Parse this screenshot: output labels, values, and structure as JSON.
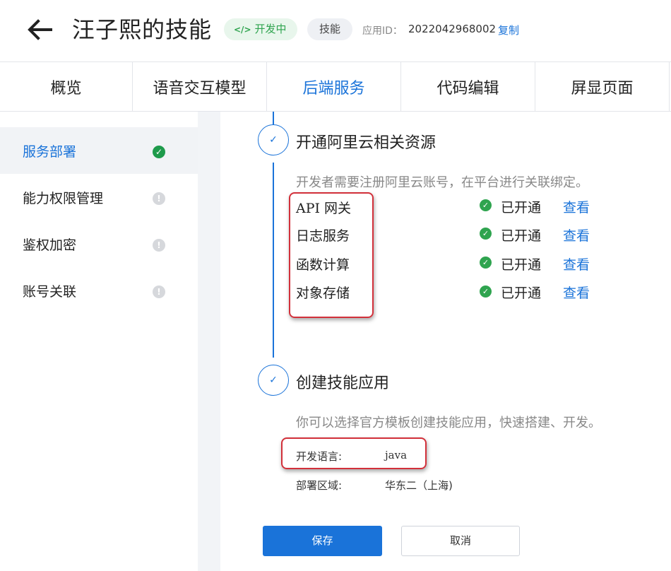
{
  "header": {
    "title": "汪子熙的技能",
    "status_code": "</>",
    "status": "开发中",
    "type": "技能",
    "app_id_label": "应用ID：",
    "app_id": "2022042968002",
    "copy_label": "复制"
  },
  "tabs": [
    {
      "label": "概览"
    },
    {
      "label": "语音交互模型"
    },
    {
      "label": "后端服务"
    },
    {
      "label": "代码编辑"
    },
    {
      "label": "屏显页面"
    }
  ],
  "sidebar": {
    "items": [
      {
        "label": "服务部署",
        "status": "done"
      },
      {
        "label": "能力权限管理",
        "status": "pending"
      },
      {
        "label": "鉴权加密",
        "status": "pending"
      },
      {
        "label": "账号关联",
        "status": "pending"
      }
    ]
  },
  "steps": [
    {
      "title": "开通阿里云相关资源",
      "desc": "开发者需要注册阿里云账号，在平台进行关联绑定。",
      "services": [
        {
          "name": "API 网关",
          "status": "已开通",
          "action": "查看"
        },
        {
          "name": "日志服务",
          "status": "已开通",
          "action": "查看"
        },
        {
          "name": "函数计算",
          "status": "已开通",
          "action": "查看"
        },
        {
          "name": "对象存储",
          "status": "已开通",
          "action": "查看"
        }
      ]
    },
    {
      "title": "创建技能应用",
      "desc": "你可以选择官方模板创建技能应用，快速搭建、开发。",
      "fields": [
        {
          "label": "开发语言:",
          "value": "java"
        },
        {
          "label": "部署区域:",
          "value": "华东二（上海)"
        }
      ]
    }
  ],
  "buttons": {
    "save": "保存",
    "cancel": "取消"
  },
  "colors": {
    "accent": "#1a73d9",
    "success": "#2fa44f",
    "highlight": "#d2303a"
  }
}
